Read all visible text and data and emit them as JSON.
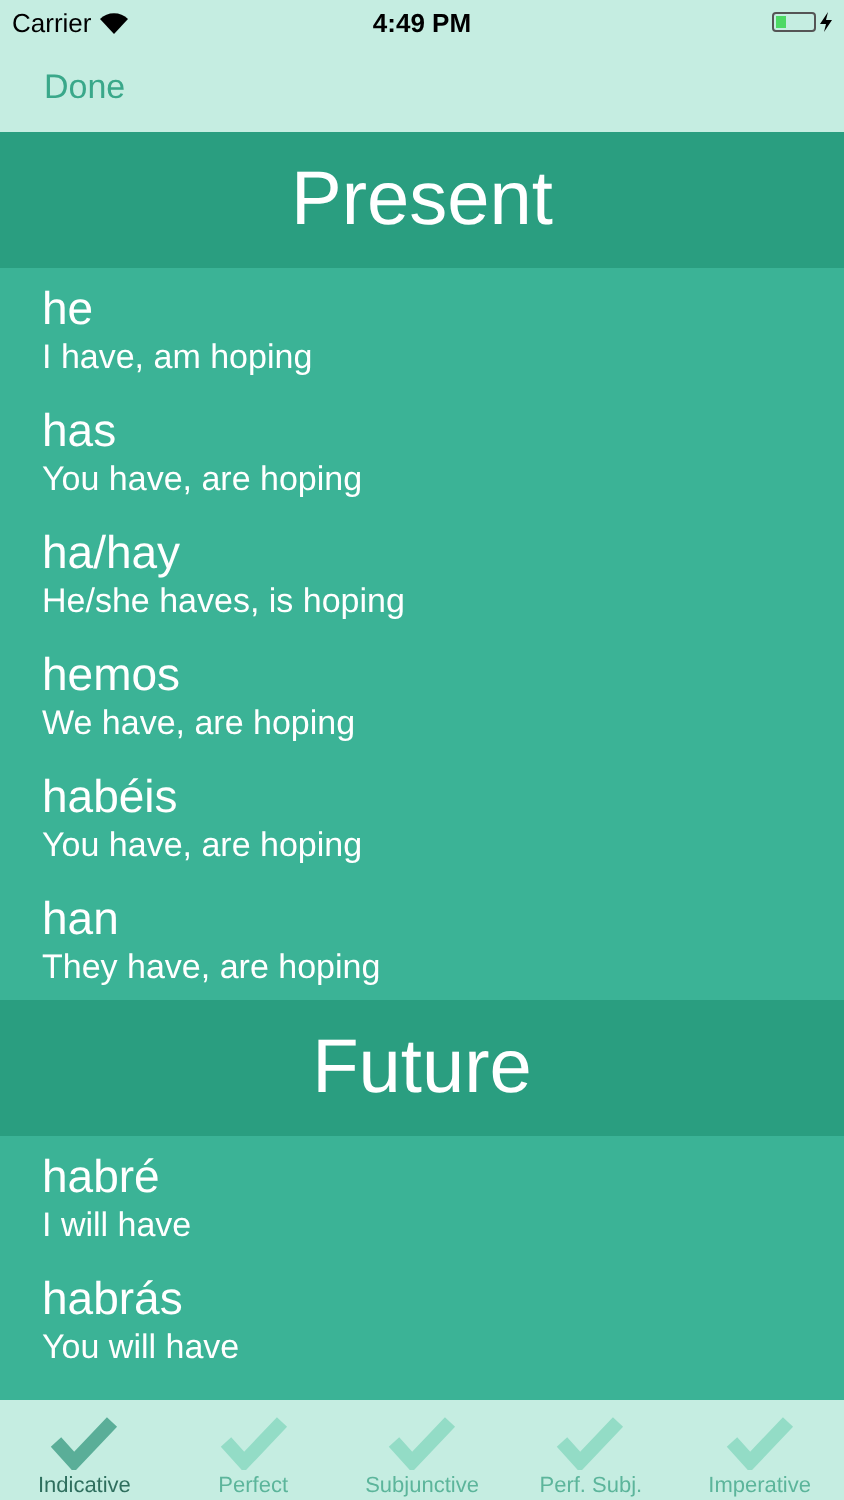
{
  "status_bar": {
    "carrier": "Carrier",
    "time": "4:49 PM"
  },
  "nav": {
    "done": "Done"
  },
  "sections": [
    {
      "title": "Present",
      "rows": [
        {
          "form": "he",
          "meaning": "I have, am hoping"
        },
        {
          "form": "has",
          "meaning": "You have, are hoping"
        },
        {
          "form": "ha/hay",
          "meaning": "He/she haves, is hoping"
        },
        {
          "form": "hemos",
          "meaning": "We have, are hoping"
        },
        {
          "form": "habéis",
          "meaning": "You have, are hoping"
        },
        {
          "form": "han",
          "meaning": "They have, are hoping"
        }
      ]
    },
    {
      "title": "Future",
      "rows": [
        {
          "form": "habré",
          "meaning": "I will have"
        },
        {
          "form": "habrás",
          "meaning": "You will have"
        }
      ]
    }
  ],
  "tabs": [
    {
      "label": "Indicative",
      "selected": true
    },
    {
      "label": "Perfect",
      "selected": false
    },
    {
      "label": "Subjunctive",
      "selected": false
    },
    {
      "label": "Perf. Subj.",
      "selected": false
    },
    {
      "label": "Imperative",
      "selected": false
    }
  ]
}
